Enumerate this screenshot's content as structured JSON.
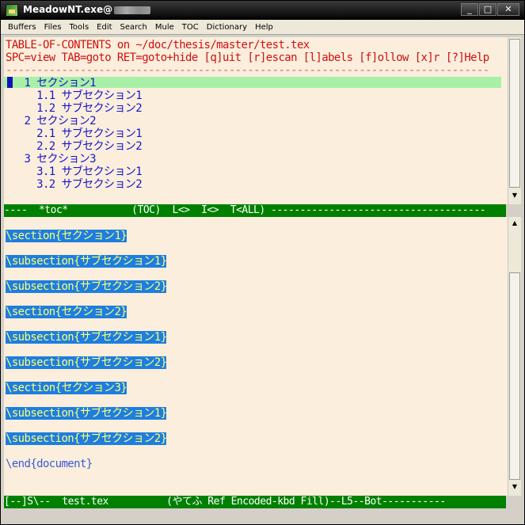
{
  "window": {
    "title": "MeadowNT.exe@",
    "buttons": {
      "minimize": "_",
      "maximize": "□",
      "close": "✕"
    }
  },
  "menubar": [
    "Buffers",
    "Files",
    "Tools",
    "Edit",
    "Search",
    "Mule",
    "TOC",
    "Dictionary",
    "Help"
  ],
  "toc": {
    "header1": "TABLE-OF-CONTENTS on ~/doc/thesis/master/test.tex",
    "header2": "SPC=view TAB=goto RET=goto+hide [q]uit [r]escan [l]abels [f]ollow [x]r [?]Help",
    "separator": "------------------------------------------------------------------------------",
    "items": [
      "   1 セクション1",
      "     1.1 サブセクション1",
      "     1.2 サブセクション2",
      "   2 セクション2",
      "     2.1 サブセクション1",
      "     2.2 サブセクション2",
      "   3 セクション3",
      "     3.1 サブセクション1",
      "     3.2 サブセクション2"
    ]
  },
  "toc_modeline": "----  *toc*           (TOC)  L<>  I<>  T<ALL) -------------------------------------",
  "document": {
    "lines": [
      "\\section{セクション1}",
      "\\subsection{サブセクション1}",
      "\\subsection{サブセクション2}",
      "\\section{セクション2}",
      "\\subsection{サブセクション1}",
      "\\subsection{サブセクション2}",
      "\\section{セクション3}",
      "\\subsection{サブセクション1}",
      "\\subsection{サブセクション2}"
    ],
    "end_line": "\\end{document}"
  },
  "doc_modeline": "[--]S\\--  test.tex          (やてふ Ref Encoded-kbd Fill)--L5--Bot-----------",
  "scroll_arrows": {
    "up": "▲",
    "down": "▼"
  }
}
